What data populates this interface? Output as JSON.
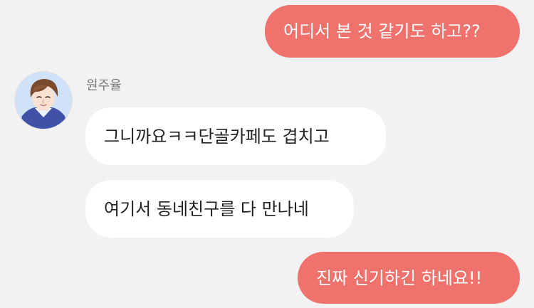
{
  "conversation": {
    "messages": [
      {
        "id": 1,
        "from": "me",
        "text": "어디서 본 것 같기도 하고??"
      },
      {
        "id": 2,
        "from": "other",
        "sender": "원주율",
        "text": "그니까요ㅋㅋ단골카페도 겹치고"
      },
      {
        "id": 3,
        "from": "other",
        "sender": "원주율",
        "text": "여기서 동네친구를 다 만나네"
      },
      {
        "id": 4,
        "from": "me",
        "text": "진짜 신기하긴 하네요!!"
      }
    ],
    "other_sender_name": "원주율"
  },
  "colors": {
    "background": "#f2f2f2",
    "my_bubble": "#ef726d",
    "other_bubble": "#ffffff",
    "my_text": "#ffffff",
    "other_text": "#222222",
    "sender_name": "#7a7a7a"
  },
  "icons": {
    "avatar": "avatar-illustration"
  }
}
